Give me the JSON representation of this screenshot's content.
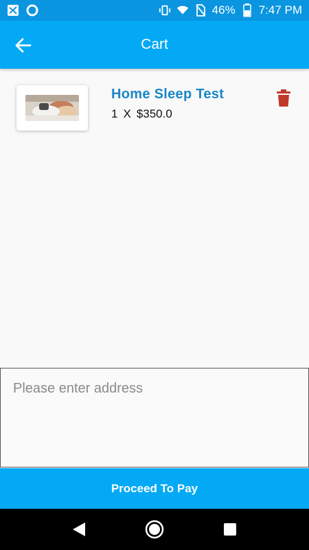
{
  "status_bar": {
    "battery": "46%",
    "time": "7:47 PM"
  },
  "app_bar": {
    "title": "Cart"
  },
  "cart": {
    "items": [
      {
        "name": "Home Sleep Test",
        "quantity": "1",
        "multiplier": "X",
        "price": "$350.0"
      }
    ]
  },
  "address": {
    "placeholder": "Please enter address",
    "value": ""
  },
  "actions": {
    "pay_label": "Proceed To Pay"
  },
  "colors": {
    "primary": "#03a9f4",
    "status_bar": "#0a95e0",
    "title_blue": "#1a86c8",
    "delete_red": "#c0392b"
  },
  "icons": [
    "back-arrow-icon",
    "trash-icon",
    "wifi-icon",
    "vibrate-icon",
    "battery-icon",
    "nav-back-icon",
    "nav-home-icon",
    "nav-recents-icon"
  ]
}
